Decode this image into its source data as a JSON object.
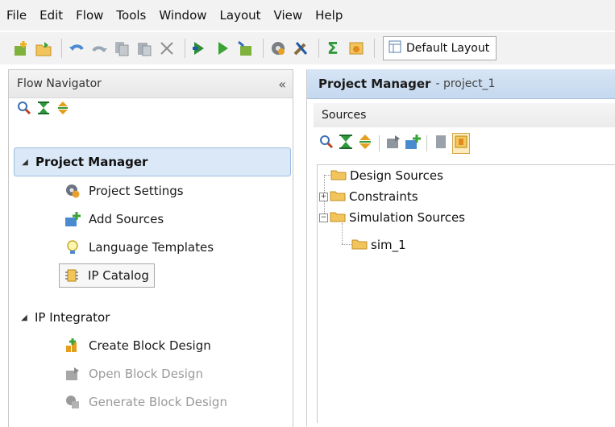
{
  "menu": [
    {
      "id": "file",
      "label": "File"
    },
    {
      "id": "edit",
      "label": "Edit"
    },
    {
      "id": "flow",
      "label": "Flow"
    },
    {
      "id": "tools",
      "label": "Tools"
    },
    {
      "id": "window",
      "label": "Window"
    },
    {
      "id": "layout",
      "label": "Layout"
    },
    {
      "id": "view",
      "label": "View"
    },
    {
      "id": "help",
      "label": "Help"
    }
  ],
  "toolbar": {
    "icons": [
      "new-project-icon",
      "open-project-icon",
      "undo-icon",
      "redo-icon",
      "copy-icon",
      "paste-icon",
      "delete-icon",
      "run-behavioral-icon",
      "run-icon",
      "open-hardware-icon",
      "settings-icon",
      "tools-icon",
      "sigma-report-icon",
      "layout-icon"
    ],
    "layout_select": "Default Layout"
  },
  "flow_navigator": {
    "title": "Flow Navigator",
    "collapse": "«",
    "sections": [
      {
        "label": "Project Manager",
        "selected": true,
        "items": [
          {
            "label": "Project Settings",
            "icon": "gear-icon",
            "enabled": true
          },
          {
            "label": "Add Sources",
            "icon": "add-sources-icon",
            "enabled": true
          },
          {
            "label": "Language Templates",
            "icon": "lightbulb-icon",
            "enabled": true
          },
          {
            "label": "IP Catalog",
            "icon": "chip-icon",
            "enabled": true,
            "boxed": true
          }
        ]
      },
      {
        "label": "IP Integrator",
        "selected": false,
        "items": [
          {
            "label": "Create Block Design",
            "icon": "create-block-icon",
            "enabled": true
          },
          {
            "label": "Open Block Design",
            "icon": "open-block-icon",
            "enabled": false
          },
          {
            "label": "Generate Block Design",
            "icon": "generate-block-icon",
            "enabled": false
          }
        ]
      }
    ]
  },
  "project_manager": {
    "title": "Project Manager",
    "project": "project_1",
    "sources_label": "Sources",
    "tree": [
      {
        "label": "Design Sources",
        "expander": ""
      },
      {
        "label": "Constraints",
        "expander": "+"
      },
      {
        "label": "Simulation Sources",
        "expander": "−"
      },
      {
        "label": "sim_1",
        "expander": ""
      }
    ]
  },
  "colors": {
    "selection_bg": "#dbe8f7",
    "header_blue": "#c4d8ef",
    "folder": "#f2c55c",
    "accent_green": "#3aa335",
    "disabled_text": "#9a9a9a"
  }
}
